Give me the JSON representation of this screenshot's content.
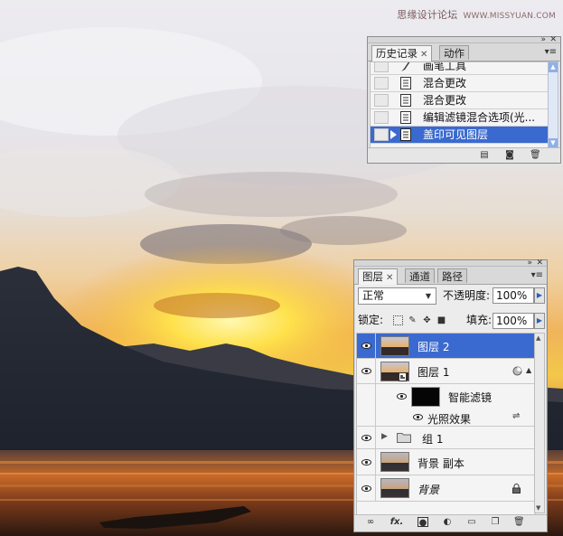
{
  "watermark": {
    "text": "思缘设计论坛",
    "site": "WWW.MISSYUAN.COM"
  },
  "history_panel": {
    "tabs": [
      {
        "label": "历史记录",
        "active": true
      },
      {
        "label": "动作",
        "active": false
      }
    ],
    "items": [
      {
        "label": "画笔工具",
        "icon": "brush-icon"
      },
      {
        "label": "混合更改",
        "icon": "document-icon"
      },
      {
        "label": "混合更改",
        "icon": "document-icon"
      },
      {
        "label": "编辑滤镜混合选项(光...",
        "icon": "document-icon"
      },
      {
        "label": "盖印可见图层",
        "icon": "document-icon",
        "selected": true
      }
    ],
    "footer_icons": [
      "new-document-icon",
      "camera-icon",
      "trash-icon"
    ]
  },
  "layers_panel": {
    "tabs": [
      {
        "label": "图层",
        "active": true
      },
      {
        "label": "通道",
        "active": false
      },
      {
        "label": "路径",
        "active": false
      }
    ],
    "blend_mode": "正常",
    "opacity_label": "不透明度:",
    "opacity_value": "100%",
    "lock_label": "锁定:",
    "fill_label": "填充:",
    "fill_value": "100%",
    "layers": [
      {
        "name": "图层 2",
        "selected": true
      },
      {
        "name": "图层 1"
      },
      {
        "name": "智能滤镜"
      },
      {
        "name": "光照效果"
      },
      {
        "name": "组 1"
      },
      {
        "name": "背景 副本"
      },
      {
        "name": "背景"
      }
    ],
    "footer_icons": [
      "link-icon",
      "fx-icon",
      "mask-icon",
      "adjustment-icon",
      "folder-icon",
      "new-layer-icon",
      "trash-icon"
    ],
    "fx_label": "fx."
  },
  "colors": {
    "selection": "#3a6ad0",
    "panel_bg": "#ececec"
  }
}
